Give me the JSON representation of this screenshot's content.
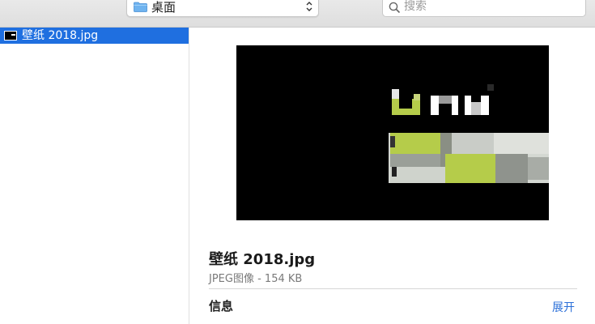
{
  "toolbar": {
    "location": "桌面",
    "search_placeholder": "搜索"
  },
  "file_list": {
    "items": [
      {
        "name": "壁纸 2018.jpg",
        "selected": true
      }
    ]
  },
  "preview": {
    "title": "壁纸 2018.jpg",
    "subtitle": "JPEG图像 - 154 KB",
    "info_label": "信息",
    "expand_label": "展开"
  },
  "colors": {
    "selection": "#1f6fe0",
    "link": "#2a6fd8",
    "accent_green": "#b5cc4a"
  },
  "icons": {
    "folder": "folder-icon",
    "stepper": "stepper-icon",
    "search": "search-icon",
    "file": "image-file-icon"
  }
}
